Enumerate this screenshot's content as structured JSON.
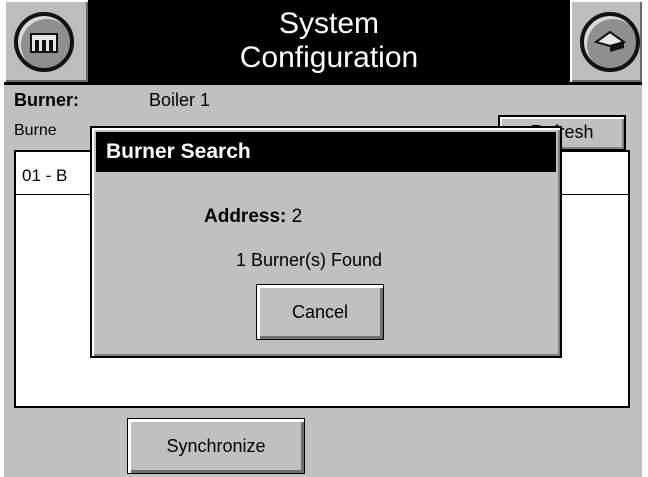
{
  "header": {
    "title_line1": "System",
    "title_line2": "Configuration",
    "left_icon": "home-icon",
    "right_icon": "back-icon"
  },
  "burner": {
    "label": "Burner:",
    "value": "Boiler 1"
  },
  "burners_label": "Burne",
  "refresh_button": "Refresh",
  "list": {
    "items": [
      "01 - B"
    ]
  },
  "synchronize_button": "Synchronize",
  "dialog": {
    "title": "Burner Search",
    "address_label": "Address:",
    "address_value": "2",
    "found_text": "1 Burner(s) Found",
    "cancel_button": "Cancel"
  }
}
